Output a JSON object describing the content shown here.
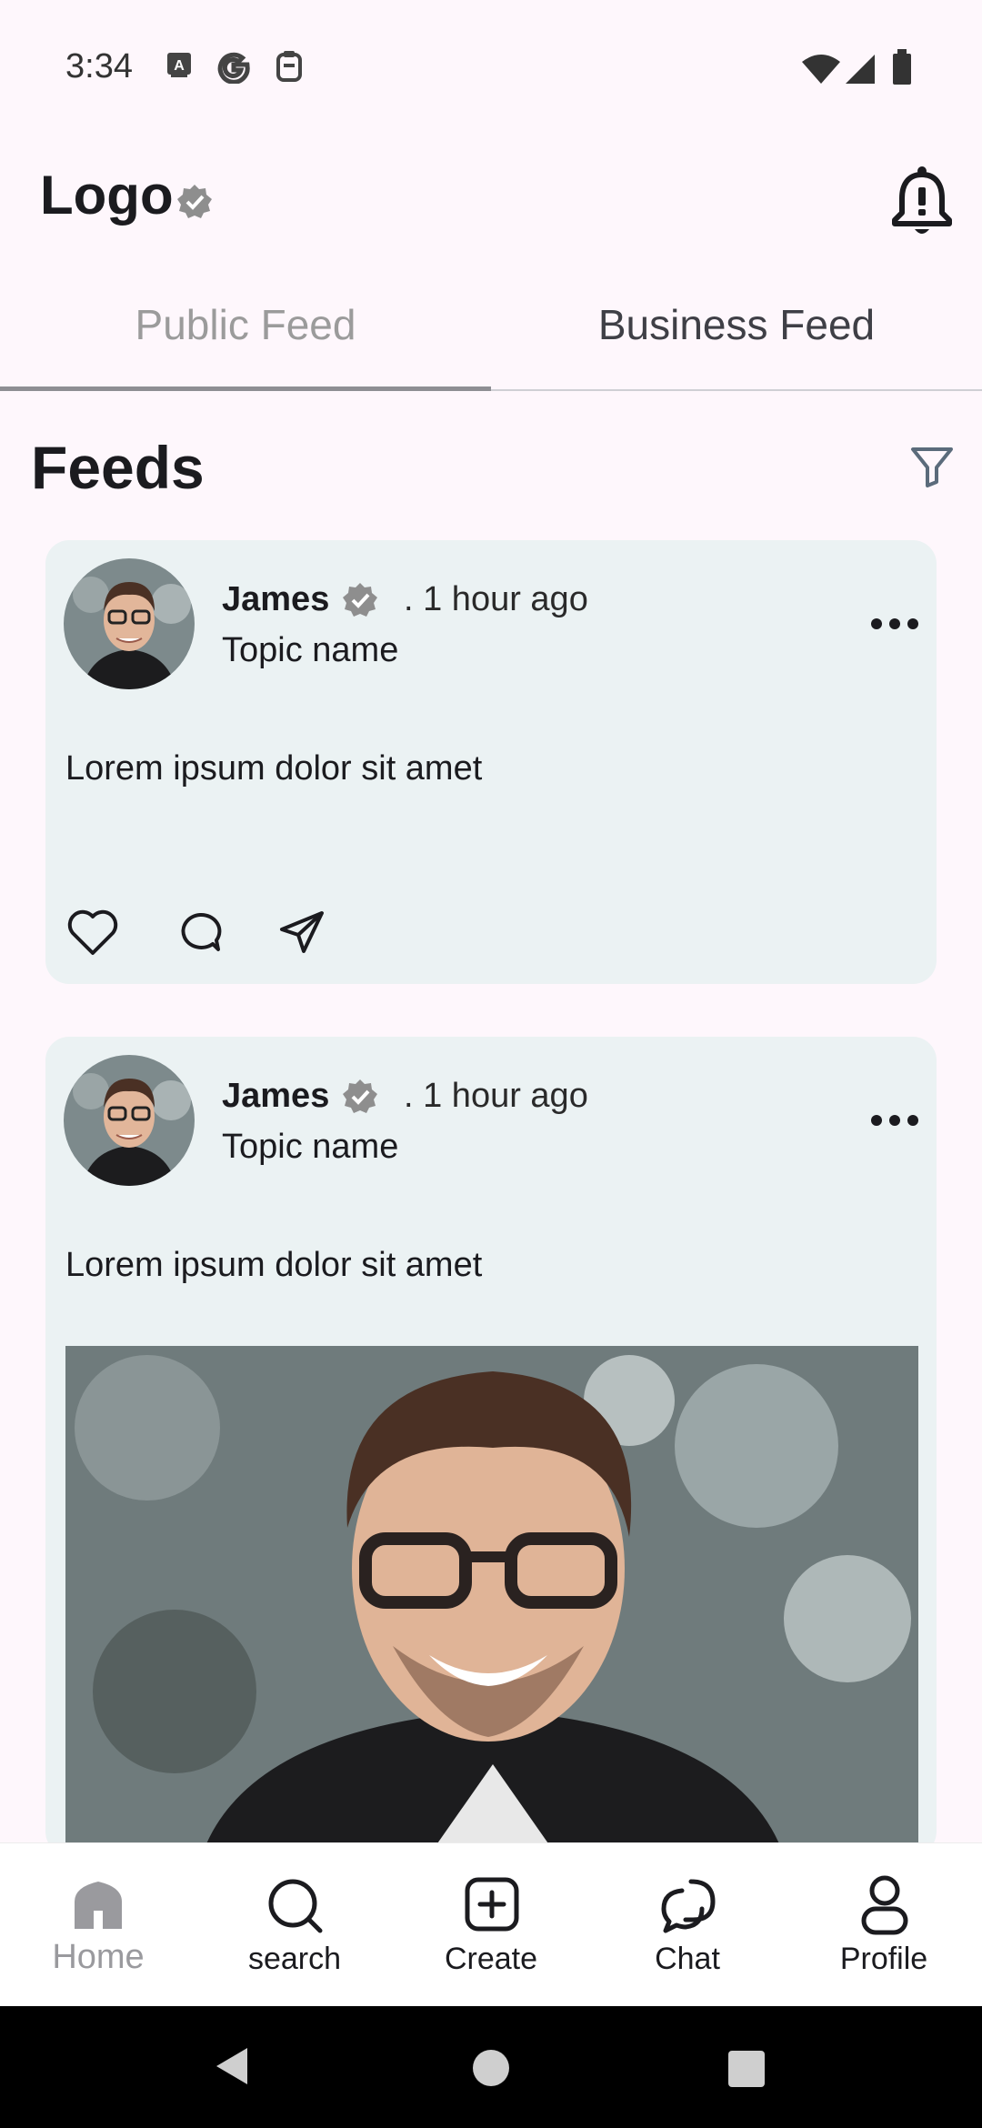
{
  "status_bar": {
    "time": "3:34",
    "left_icons": [
      "keyboard-a-icon",
      "google-g-icon",
      "clipboard-icon"
    ],
    "right_icons": [
      "wifi-icon",
      "signal-icon",
      "battery-icon"
    ]
  },
  "header": {
    "logo": "Logo",
    "verified_icon": "verified-badge-icon",
    "notification_icon": "bell-alert-icon"
  },
  "tabs": [
    {
      "label": "Public Feed",
      "active": true
    },
    {
      "label": "Business Feed",
      "active": false
    }
  ],
  "feeds": {
    "title": "Feeds",
    "filter_icon": "filter-icon"
  },
  "posts": [
    {
      "author": "James",
      "time": ". 1 hour ago",
      "topic": "Topic name",
      "text": "Lorem ipsum dolor sit amet",
      "has_image": false
    },
    {
      "author": "James",
      "time": ". 1 hour ago",
      "topic": "Topic name",
      "text": "Lorem ipsum dolor sit amet",
      "has_image": true
    }
  ],
  "bottom_nav": [
    {
      "label": "Home",
      "icon": "home-icon",
      "active": true
    },
    {
      "label": "search",
      "icon": "search-icon",
      "active": false
    },
    {
      "label": "Create",
      "icon": "plus-square-icon",
      "active": false
    },
    {
      "label": "Chat",
      "icon": "chat-icon",
      "active": false
    },
    {
      "label": "Profile",
      "icon": "profile-icon",
      "active": false
    }
  ],
  "colors": {
    "background": "#FEF7FC",
    "card": "#EBF2F3",
    "verified": "#8e8e8e",
    "filter": "#5b6b7b"
  }
}
